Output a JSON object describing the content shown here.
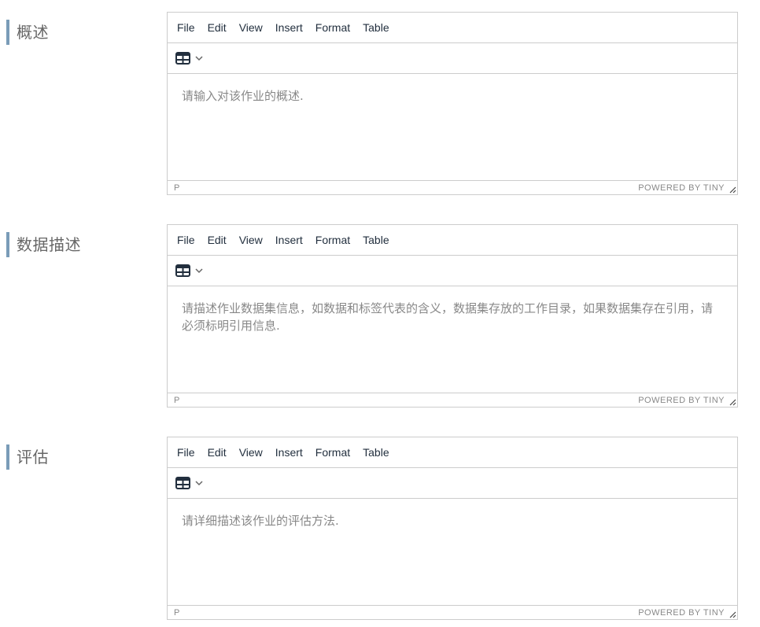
{
  "menu": [
    "File",
    "Edit",
    "View",
    "Insert",
    "Format",
    "Table"
  ],
  "sections": [
    {
      "label": "概述",
      "placeholder": "请输入对该作业的概述.",
      "path": "P",
      "branding": "POWERED BY TINY"
    },
    {
      "label": "数据描述",
      "placeholder": "请描述作业数据集信息，如数据和标签代表的含义，数据集存放的工作目录，如果数据集存在引用，请必须标明引用信息.",
      "path": "P",
      "branding": "POWERED BY TINY"
    },
    {
      "label": "评估",
      "placeholder": "请详细描述该作业的评估方法.",
      "path": "P",
      "branding": "POWERED BY TINY"
    }
  ],
  "icons": {
    "table": "table-icon",
    "chevron": "chevron-down-icon",
    "resize": "resize-handle-icon"
  },
  "colors": {
    "label_bar": "#7a9cb8",
    "border": "#cccccc",
    "text": "#222f3e",
    "placeholder": "#888888"
  }
}
